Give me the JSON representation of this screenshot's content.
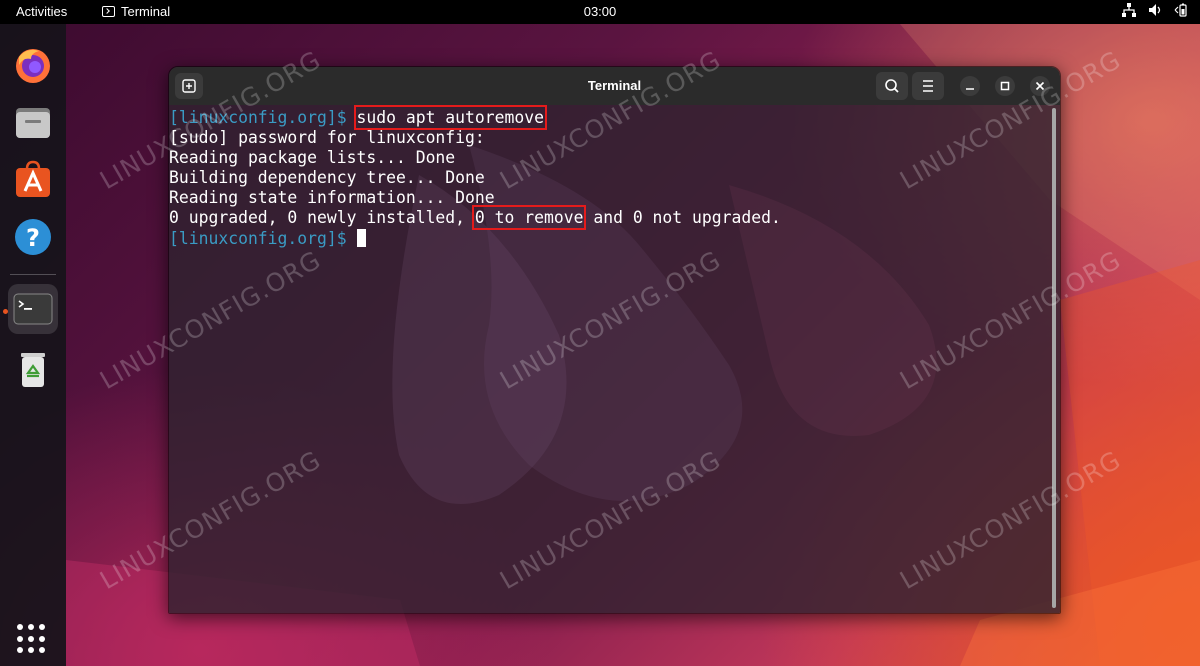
{
  "topbar": {
    "activities": "Activities",
    "app_name": "Terminal",
    "clock": "03:00"
  },
  "dock": {
    "apps": [
      "Firefox",
      "Files",
      "Ubuntu Software",
      "Help",
      "Terminal",
      "Trash"
    ],
    "active_app": "Terminal"
  },
  "window": {
    "title": "Terminal"
  },
  "terminal": {
    "line1": {
      "prompt": "[linuxconfig.org]$ ",
      "command": "sudo apt autoremove"
    },
    "line2": "[sudo] password for linuxconfig:",
    "line3": "Reading package lists... Done",
    "line4": "Building dependency tree... Done",
    "line5": "Reading state information... Done",
    "line6": {
      "before": "0 upgraded, 0 newly installed, ",
      "highlight": "0 to remove",
      "after": " and 0 not upgraded."
    },
    "line7": {
      "prompt": "[linuxconfig.org]$ "
    }
  },
  "watermark": "LINUXCONFIG.ORG",
  "colors": {
    "prompt": "#3a9bc4",
    "highlight_box": "#e41b1b",
    "accent": "#e95420"
  }
}
